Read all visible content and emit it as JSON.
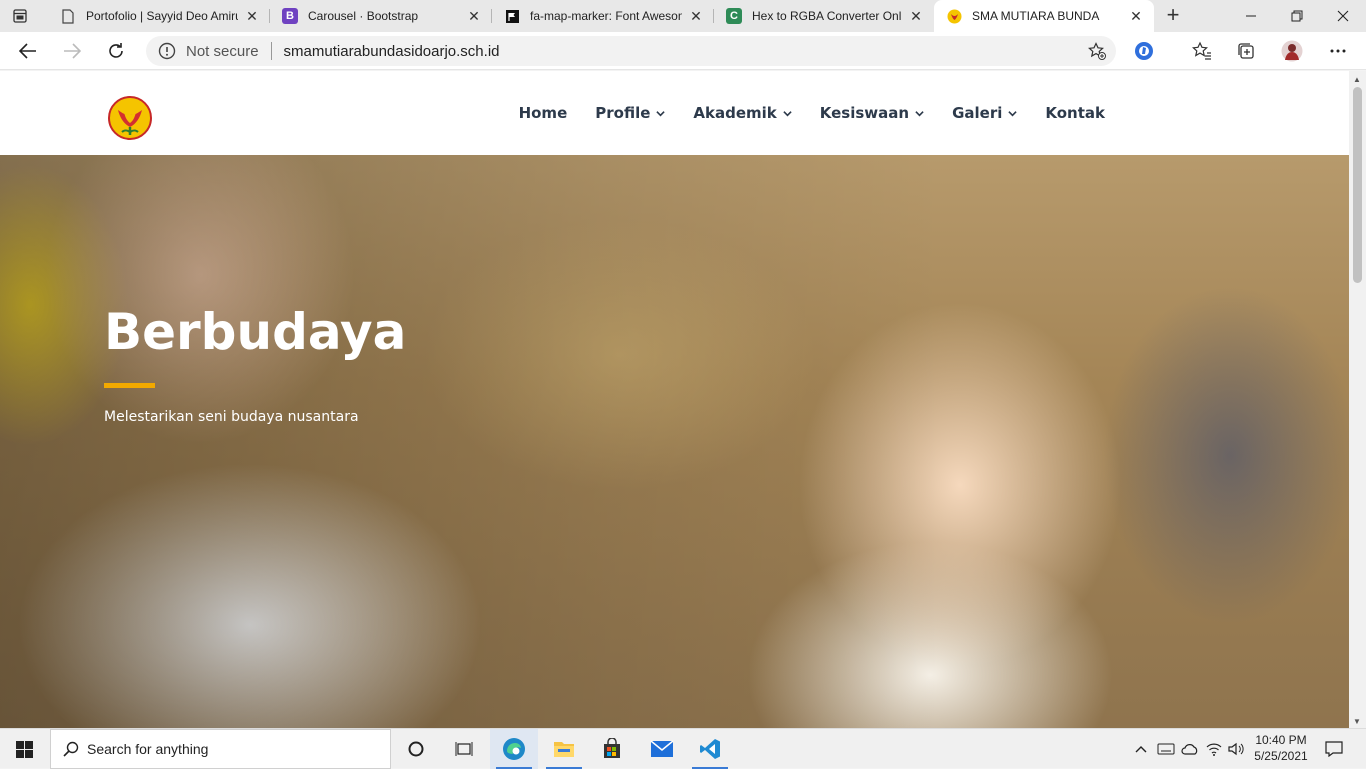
{
  "browser": {
    "tabs": [
      {
        "title": "Portofolio | Sayyid Deo Amiru",
        "icon": "page-icon"
      },
      {
        "title": "Carousel · Bootstrap",
        "icon": "bootstrap-icon"
      },
      {
        "title": "fa-map-marker: Font Awesom",
        "icon": "flag-icon"
      },
      {
        "title": "Hex to RGBA Converter Onlin",
        "icon": "c-logo-icon"
      },
      {
        "title": "SMA MUTIARA BUNDA",
        "icon": "school-logo-icon"
      }
    ],
    "address": {
      "security_label": "Not secure",
      "url": "smamutiarabundasidoarjo.sch.id"
    }
  },
  "site": {
    "menu": [
      {
        "label": "Home",
        "dropdown": false
      },
      {
        "label": "Profile",
        "dropdown": true
      },
      {
        "label": "Akademik",
        "dropdown": true
      },
      {
        "label": "Kesiswaan",
        "dropdown": true
      },
      {
        "label": "Galeri",
        "dropdown": true
      },
      {
        "label": "Kontak",
        "dropdown": false
      }
    ],
    "hero": {
      "title": "Berbudaya",
      "subtitle": "Melestarikan seni budaya nusantara"
    },
    "colors": {
      "accent": "#f2a900",
      "nav_text": "#2d3a4b",
      "whatsapp": "#25d366"
    }
  },
  "taskbar": {
    "search_placeholder": "Search for anything",
    "time": "10:40 PM",
    "date": "5/25/2021"
  }
}
